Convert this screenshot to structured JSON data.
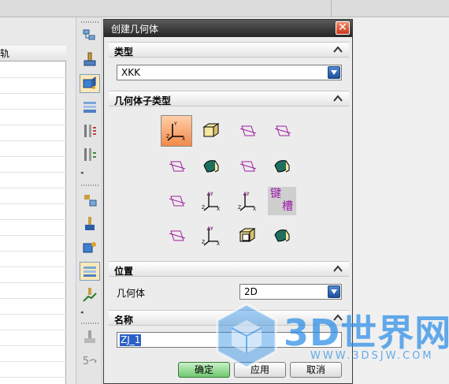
{
  "background": {
    "table_header": "轨"
  },
  "dialog": {
    "title": "创建几何体",
    "close_glyph": "✕",
    "sections": {
      "type_label": "类型",
      "subtype_label": "几何体子类型",
      "position_label": "位置",
      "name_label": "名称"
    },
    "type_select_value": "XKK",
    "geometry_label": "几何体",
    "geometry_select_value": "2D",
    "name_value": "ZJ_1",
    "keyslot": {
      "line1": "键",
      "line2": "槽"
    },
    "buttons": {
      "ok": "确定",
      "apply": "应用",
      "cancel": "取消"
    }
  },
  "toolbar": {
    "small_label": "5"
  },
  "watermark": {
    "text": "3D世界网",
    "url": "WWW.3DSJW.COM"
  },
  "colors": {
    "titlebar": "#262626",
    "close": "#c8381a",
    "selection": "#2a5fc7",
    "selected_icon": "#f28a4a",
    "watermark": "#288ce6"
  }
}
